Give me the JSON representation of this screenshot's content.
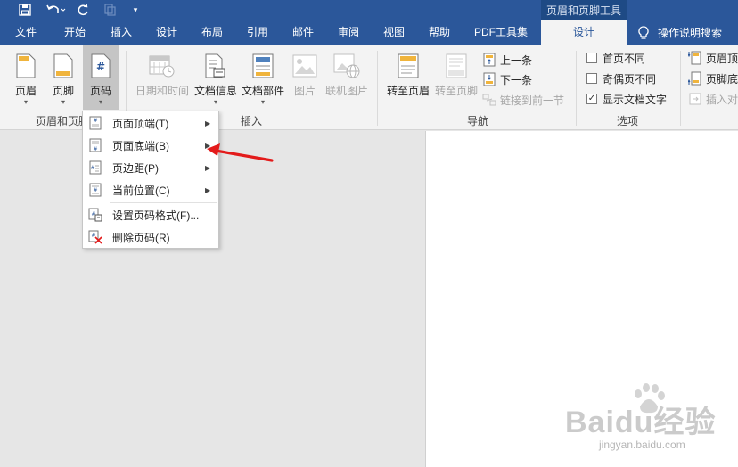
{
  "context_tab_title": "页眉和页脚工具",
  "menu_tabs": [
    {
      "label": "文件"
    },
    {
      "label": "开始"
    },
    {
      "label": "插入"
    },
    {
      "label": "设计"
    },
    {
      "label": "布局"
    },
    {
      "label": "引用"
    },
    {
      "label": "邮件"
    },
    {
      "label": "审阅"
    },
    {
      "label": "视图"
    },
    {
      "label": "帮助"
    },
    {
      "label": "PDF工具集"
    },
    {
      "label": "设计"
    }
  ],
  "tell_me": "操作说明搜索",
  "ribbon": {
    "header_footer": {
      "header": "页眉",
      "footer": "页脚",
      "page_number": "页码",
      "group_label": "页眉和页脚"
    },
    "insert": {
      "date_time": "日期和时间",
      "doc_info": "文档信息",
      "doc_parts": "文档部件",
      "picture": "图片",
      "online_picture": "联机图片",
      "group_label": "插入"
    },
    "navigation": {
      "goto_header": "转至页眉",
      "goto_footer": "转至页脚",
      "previous": "上一条",
      "next": "下一条",
      "link_previous": "链接到前一节",
      "group_label": "导航"
    },
    "options": {
      "different_first": "首页不同",
      "different_odd_even": "奇偶页不同",
      "show_doc_text": "显示文档文字",
      "group_label": "选项"
    },
    "position": {
      "header_top": "页眉顶",
      "footer_bottom": "页脚底",
      "insert_align": "插入对"
    }
  },
  "dropdown": {
    "items": [
      {
        "label": "页面顶端(T)"
      },
      {
        "label": "页面底端(B)"
      },
      {
        "label": "页边距(P)"
      },
      {
        "label": "当前位置(C)"
      },
      {
        "label": "设置页码格式(F)..."
      },
      {
        "label": "删除页码(R)"
      }
    ]
  },
  "watermark": {
    "main": "Baidu经验",
    "sub": "jingyan.baidu.com"
  },
  "colors": {
    "brand_blue": "#2b579a",
    "context_blue": "#1e4a85",
    "arrow_red": "#e31b1b"
  }
}
